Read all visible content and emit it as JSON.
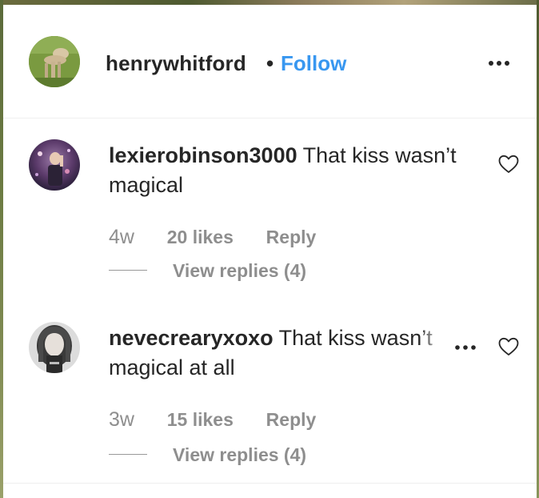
{
  "post": {
    "username": "henrywhitford",
    "separator": "•",
    "follow_label": "Follow",
    "more_icon": "more-horizontal-icon"
  },
  "comments": [
    {
      "username": "lexierobinson3000",
      "text": " That kiss wasn’t magical",
      "time": "4w",
      "likes": "20 likes",
      "reply_label": "Reply",
      "view_replies": "View replies (4)"
    },
    {
      "username": "nevecrearyxoxo",
      "text": " That kiss wasn’t magical at all",
      "time": "3w",
      "likes": "15 likes",
      "reply_label": "Reply",
      "view_replies": "View replies (4)"
    }
  ],
  "colors": {
    "link": "#3897f0",
    "secondary_text": "#8e8e8e",
    "primary_text": "#262626"
  }
}
